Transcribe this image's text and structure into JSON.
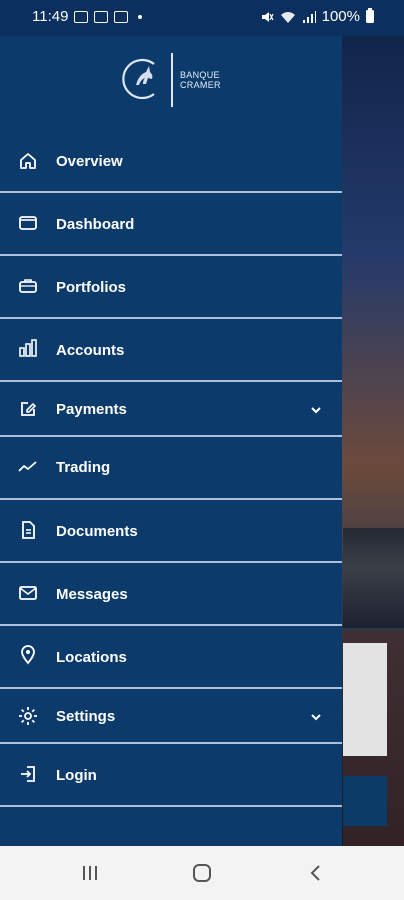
{
  "status_bar": {
    "time": "11:49",
    "battery": "100%"
  },
  "logo": {
    "line1": "BANQUE",
    "line2": "CRAMER"
  },
  "menu": {
    "items": [
      {
        "label": "Overview",
        "icon": "home-icon"
      },
      {
        "label": "Dashboard",
        "icon": "folder-icon"
      },
      {
        "label": "Portfolios",
        "icon": "briefcase-icon"
      },
      {
        "label": "Accounts",
        "icon": "bar-chart-icon"
      },
      {
        "label": "Payments",
        "icon": "edit-icon",
        "has_chevron": true
      },
      {
        "label": "Trading",
        "icon": "trend-icon"
      },
      {
        "label": "Documents",
        "icon": "document-icon"
      },
      {
        "label": "Messages",
        "icon": "mail-icon"
      },
      {
        "label": "Locations",
        "icon": "location-pin-icon"
      },
      {
        "label": "Settings",
        "icon": "gear-icon",
        "has_chevron": true
      },
      {
        "label": "Login",
        "icon": "login-icon"
      }
    ]
  },
  "colors": {
    "drawer_bg": "#0b3a6b",
    "status_bg": "#0b2f5f",
    "navbar_bg": "#f3f3f3"
  }
}
